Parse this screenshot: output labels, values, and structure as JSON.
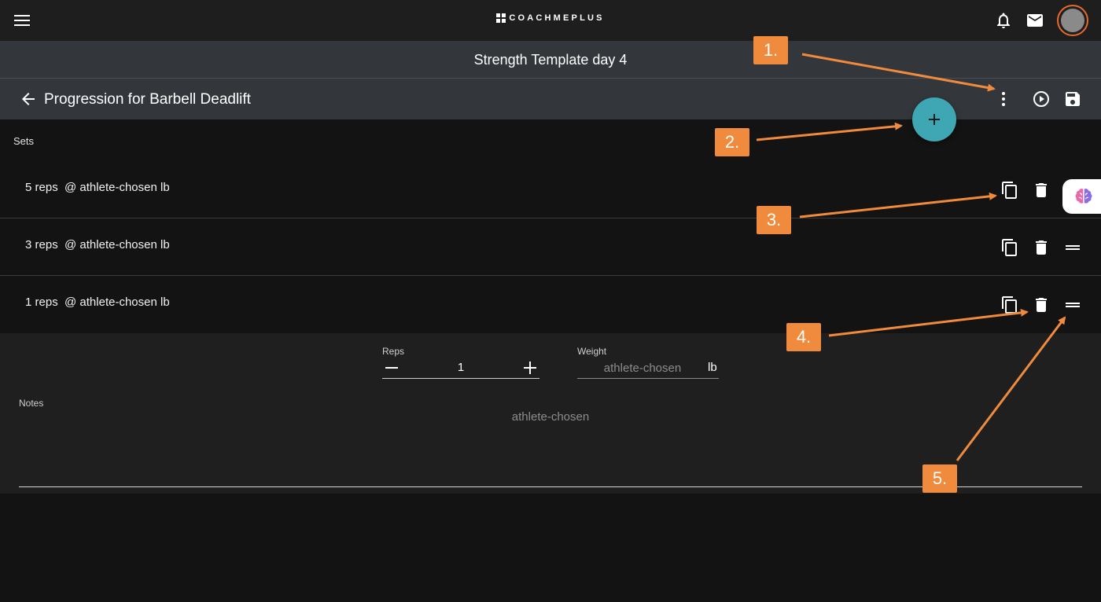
{
  "brand": {
    "name": "COACHMEPLUS"
  },
  "header": {
    "template_title": "Strength Template day 4"
  },
  "toolbar": {
    "page_title": "Progression for Barbell Deadlift"
  },
  "sets": {
    "label": "Sets",
    "rows": [
      {
        "text": "5 reps  @ athlete-chosen lb"
      },
      {
        "text": "3 reps  @ athlete-chosen lb"
      },
      {
        "text": "1 reps  @ athlete-chosen lb"
      }
    ]
  },
  "editor": {
    "reps_label": "Reps",
    "reps_value": "1",
    "weight_label": "Weight",
    "weight_placeholder": "athlete-chosen",
    "weight_unit": "lb",
    "notes_label": "Notes",
    "notes_placeholder": "athlete-chosen"
  },
  "callouts": [
    "1.",
    "2.",
    "3.",
    "4.",
    "5."
  ],
  "colors": {
    "accent_teal": "#3fa6b3",
    "callout_orange": "#f08a3c",
    "avatar_ring": "#e8692c",
    "toolbar_bg": "#33373c",
    "topbar_bg": "#1e1e1e",
    "page_bg": "#131313"
  },
  "icons": {
    "menu": "hamburger-menu-icon",
    "notifications": "bell-icon",
    "messages": "mail-icon",
    "back": "arrow-left-icon",
    "more": "more-vertical-icon",
    "play": "play-circle-icon",
    "save": "floppy-disk-icon",
    "add": "plus-icon",
    "copy": "copy-icon",
    "delete": "trash-icon",
    "drag": "drag-handle-icon",
    "decrement": "minus-icon",
    "increment": "plus-icon",
    "assistant": "brain-icon"
  }
}
